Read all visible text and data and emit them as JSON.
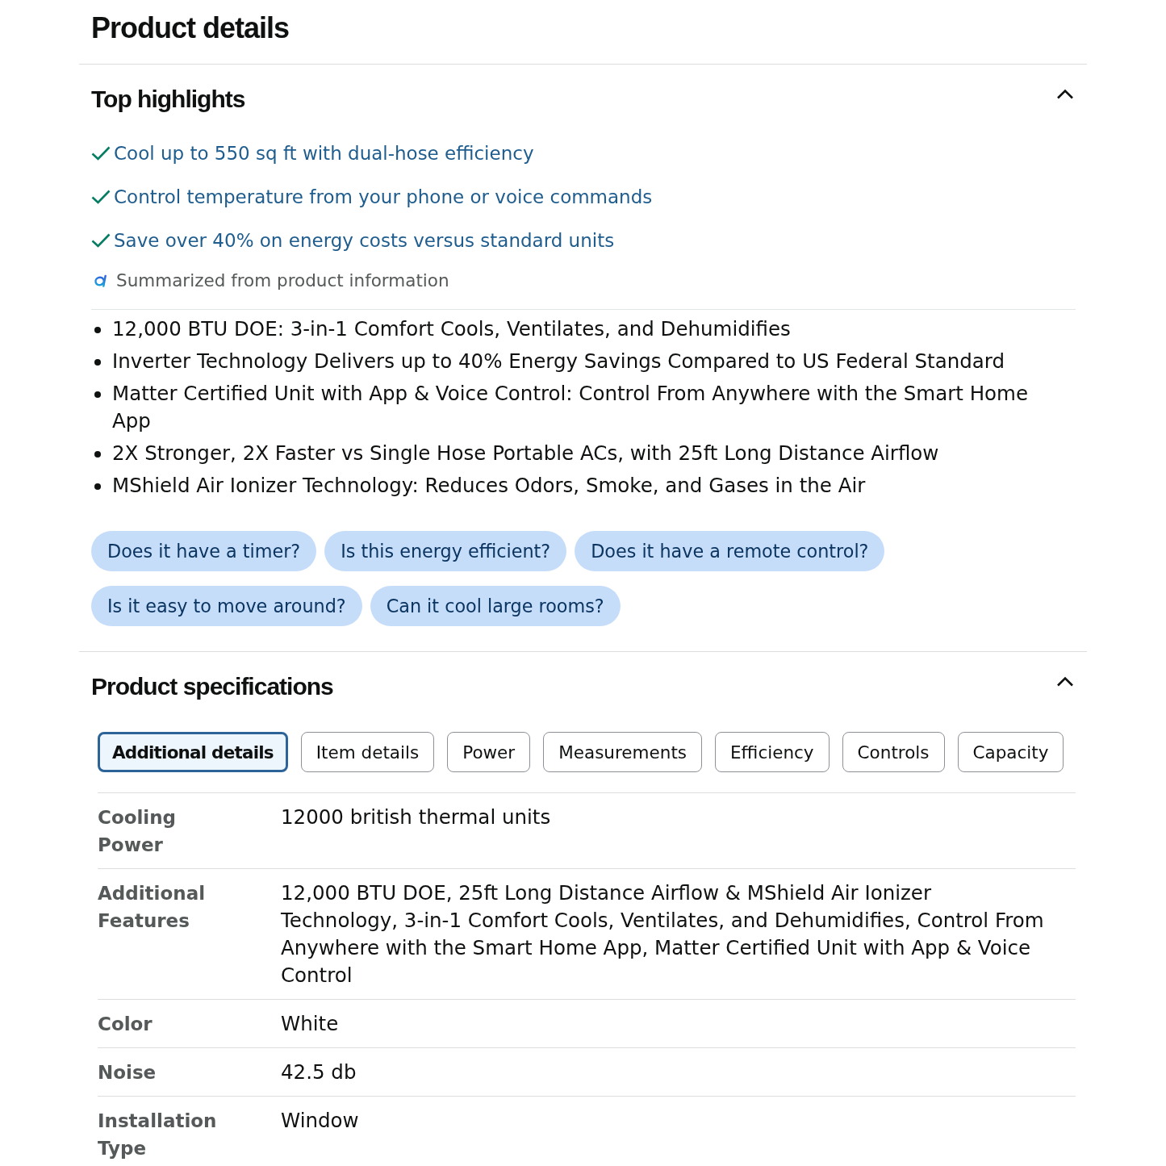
{
  "page_title": "Product details",
  "top_highlights": {
    "title": "Top highlights",
    "expanded": true,
    "highlights": [
      "Cool up to 550 sq ft with dual-hose efficiency",
      "Control temperature from your phone or voice commands",
      "Save over 40% on energy costs versus standard units"
    ],
    "summary_note": "Summarized from product information",
    "bullets": [
      "12,000 BTU DOE: 3-in-1 Comfort Cools, Ventilates, and Dehumidifies",
      "Inverter Technology Delivers up to 40% Energy Savings Compared to US Federal Standard",
      "Matter Certified Unit with App & Voice Control: Control From Anywhere with the Smart Home App",
      "2X Stronger, 2X Faster vs Single Hose Portable ACs, with 25ft Long Distance Airflow",
      "MShield Air Ionizer Technology: Reduces Odors, Smoke, and Gases in the Air"
    ],
    "questions": [
      "Does it have a timer?",
      "Is this energy efficient?",
      "Does it have a remote control?",
      "Is it easy to move around?",
      "Can it cool large rooms?"
    ]
  },
  "product_specifications": {
    "title": "Product specifications",
    "expanded": true,
    "tabs": [
      {
        "label": "Additional details",
        "selected": true
      },
      {
        "label": "Item details",
        "selected": false
      },
      {
        "label": "Power",
        "selected": false
      },
      {
        "label": "Measurements",
        "selected": false
      },
      {
        "label": "Efficiency",
        "selected": false
      },
      {
        "label": "Controls",
        "selected": false
      },
      {
        "label": "Capacity",
        "selected": false
      }
    ],
    "rows": [
      {
        "label": "Cooling Power",
        "value": "12000 british thermal units"
      },
      {
        "label": "Additional Features",
        "value": "12,000 BTU DOE, 25ft Long Distance Airflow & MShield Air Ionizer Technology, 3-in-1 Comfort Cools, Ventilates, and Dehumidifies, Control From Anywhere with the Smart Home App, Matter Certified Unit with App & Voice Control"
      },
      {
        "label": "Color",
        "value": "White"
      },
      {
        "label": "Noise",
        "value": "42.5 db"
      },
      {
        "label": "Installation Type",
        "value": "Window"
      }
    ]
  }
}
